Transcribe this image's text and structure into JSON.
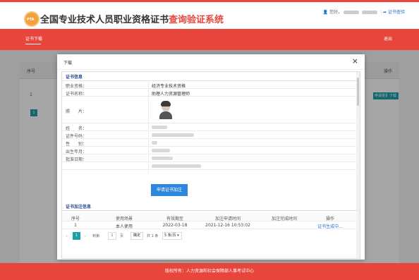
{
  "header": {
    "logo_text": "PTA",
    "title_main": "全国专业技术人员职业资格证书",
    "title_sub": "查询验证系统",
    "user_icon": "user-icon",
    "user_greeting": "您好，",
    "user_link": "证书查验"
  },
  "nav": {
    "tab_label": "证书下载",
    "logout_label": "退出"
  },
  "background_table": {
    "col_num": "序号",
    "col_op": "操作",
    "row_num": "1",
    "btn_apply": "申请变更",
    "btn_download": "下载",
    "page": "1"
  },
  "modal": {
    "title": "下载",
    "close": "×",
    "cert_section_title": "证书信息",
    "rows": [
      {
        "label": "职业资格：",
        "value": "经济专业技术资格"
      },
      {
        "label": "证书名称：",
        "value": "助理人力资源管理师"
      },
      {
        "label": "照　　片：",
        "value": ""
      },
      {
        "label": "姓　　名：",
        "value": ""
      },
      {
        "label": "证件号码：",
        "value": ""
      },
      {
        "label": "性　　别：",
        "value": ""
      },
      {
        "label": "出生年月：",
        "value": ""
      },
      {
        "label": "批准日期：",
        "value": ""
      }
    ],
    "apply_button": "申请证书加注",
    "note_section_title": "证书加注信息",
    "note_table": {
      "headers": [
        "序号",
        "使用场景",
        "有效期至",
        "加注申请时间",
        "加注完成时间",
        "操作"
      ],
      "rows": [
        {
          "num": "1",
          "scene": "本人使用",
          "valid": "2022-03-18",
          "apply_time": "2021-12-16 10:53:02",
          "done_time": "",
          "op": "证书生成中..."
        }
      ]
    },
    "pager": {
      "current": "1",
      "goto_label": "到第",
      "goto_value": "1",
      "page_unit": "页",
      "confirm": "确定",
      "total": "共 1 条",
      "size": "5 条/页"
    }
  },
  "footer": {
    "text": "版权所有：人力资源和社会保障部人事考试中心"
  }
}
